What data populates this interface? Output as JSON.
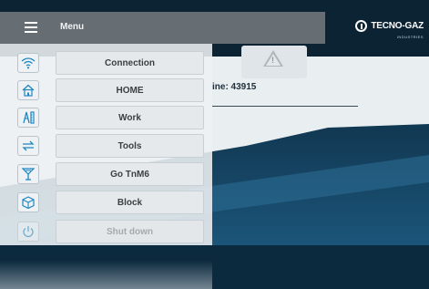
{
  "header": {
    "menu_title": "Menu"
  },
  "brand": {
    "name": "TECNO-GAZ",
    "tagline": "INDUSTRIES"
  },
  "background": {
    "serial_text": "ine: 43915"
  },
  "menu": {
    "items": [
      {
        "label": "Connection",
        "icon": "wifi-icon"
      },
      {
        "label": "HOME",
        "icon": "home-icon"
      },
      {
        "label": "Work",
        "icon": "work-tools-icon"
      },
      {
        "label": "Tools",
        "icon": "swap-arrows-icon"
      },
      {
        "label": "Go TnM6",
        "icon": "antenna-icon"
      },
      {
        "label": "Block",
        "icon": "cube-icon"
      },
      {
        "label": "Shut down",
        "icon": "power-icon"
      }
    ]
  },
  "colors": {
    "accent": "#1f86c0",
    "menu_header": "#6e7479",
    "topbar": "#0c2334"
  }
}
